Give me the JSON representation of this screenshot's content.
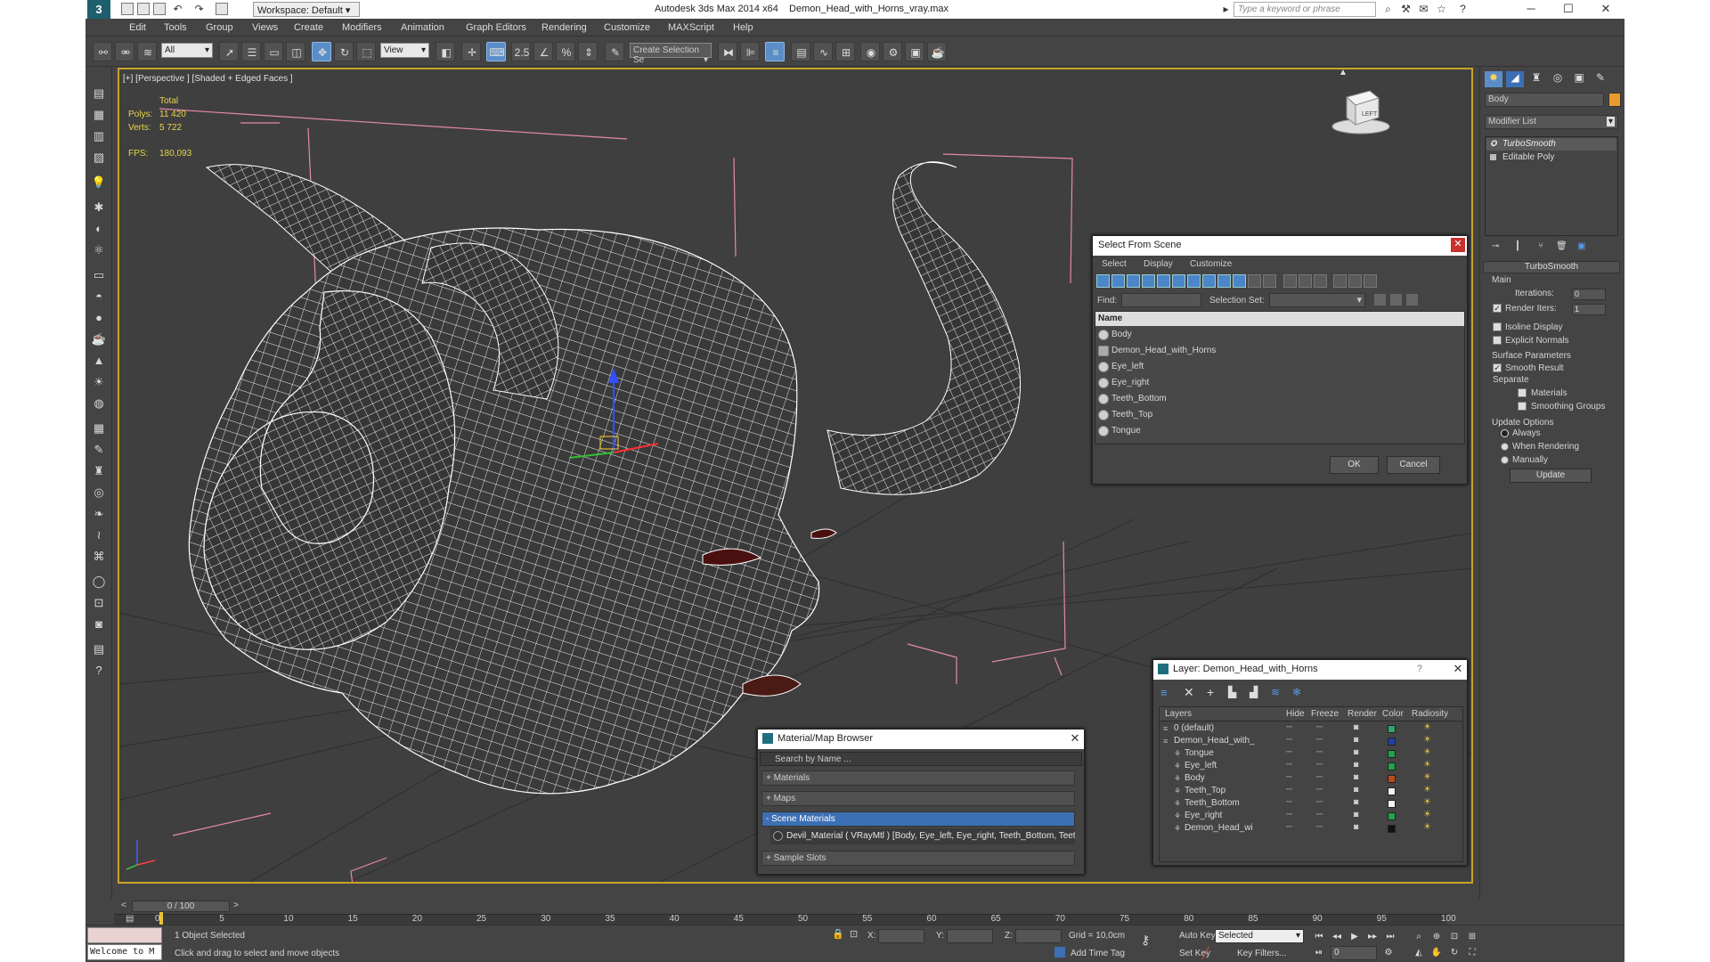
{
  "window": {
    "app_title": "Autodesk 3ds Max  2014 x64",
    "file_name": "Demon_Head_with_Horns_vray.max",
    "workspace": "Workspace: Default",
    "search_placeholder": "Type a keyword or phrase",
    "minimize": "─",
    "maximize": "☐",
    "close": "✕"
  },
  "menu": [
    "Edit",
    "Tools",
    "Group",
    "Views",
    "Create",
    "Modifiers",
    "Animation",
    "Graph Editors",
    "Rendering",
    "Customize",
    "MAXScript",
    "Help"
  ],
  "toolbar": {
    "selection_filter": "All",
    "ref_coord": "View",
    "snap_label": "2.5",
    "angle_snap": "%",
    "named_selection": "Create Selection Se"
  },
  "viewport": {
    "label": "[+] [Perspective ] [Shaded + Edged Faces ]",
    "stats": {
      "total_label": "Total",
      "polys_label": "Polys:",
      "polys_value": "11 420",
      "verts_label": "Verts:",
      "verts_value": "5 722",
      "fps_label": "FPS:",
      "fps_value": "180,093"
    },
    "viewcube_label": "LEFT"
  },
  "select_from_scene": {
    "title": "Select From Scene",
    "menus": [
      "Select",
      "Display",
      "Customize"
    ],
    "find_label": "Find:",
    "selection_set_label": "Selection Set:",
    "column_name": "Name",
    "objects": [
      "Body",
      "Demon_Head_with_Horns",
      "Eye_left",
      "Eye_right",
      "Teeth_Bottom",
      "Teeth_Top",
      "Tongue"
    ],
    "ok": "OK",
    "cancel": "Cancel"
  },
  "material_browser": {
    "title": "Material/Map Browser",
    "search_placeholder": "Search by Name ...",
    "groups": [
      "+ Materials",
      "+ Maps",
      "- Scene Materials"
    ],
    "scene_material": "Devil_Material  ( VRayMtl )  [Body, Eye_left, Eye_right, Teeth_Bottom, Teeth_To...",
    "sample_slots": "+ Sample Slots"
  },
  "layer_dialog": {
    "title": "Layer: Demon_Head_with_Horns",
    "help": "?",
    "columns": [
      "Layers",
      "Hide",
      "Freeze",
      "Render",
      "Color",
      "Radiosity"
    ],
    "layers": [
      {
        "name": "0 (default)",
        "color": "#2fa56a"
      },
      {
        "name": "Demon_Head_with_",
        "color": "#1f3fa5"
      },
      {
        "name": "Tongue",
        "color": "#22a04a"
      },
      {
        "name": "Eye_left",
        "color": "#22a04a"
      },
      {
        "name": "Body",
        "color": "#b84a1e"
      },
      {
        "name": "Teeth_Top",
        "color": "#f2f2f2"
      },
      {
        "name": "Teeth_Bottom",
        "color": "#f2f2f2"
      },
      {
        "name": "Eye_right",
        "color": "#22a04a"
      },
      {
        "name": "Demon_Head_wi",
        "color": "#111111"
      }
    ]
  },
  "command_panel": {
    "object_name": "Body",
    "object_color": "#e89b2a",
    "modifier_list": "Modifier List",
    "stack": [
      "TurboSmooth",
      "Editable Poly"
    ],
    "rollout_title": "TurboSmooth",
    "main_label": "Main",
    "iterations_label": "Iterations:",
    "iterations_value": "0",
    "render_iters_label": "Render Iters:",
    "render_iters_value": "1",
    "render_iters_checked": true,
    "isoline_display": "Isoline Display",
    "explicit_normals": "Explicit Normals",
    "surface_params": "Surface Parameters",
    "smooth_result": "Smooth Result",
    "smooth_result_checked": true,
    "separate": "Separate",
    "materials": "Materials",
    "smoothing_groups": "Smoothing Groups",
    "update_options": "Update Options",
    "always": "Always",
    "when_rendering": "When Rendering",
    "manually": "Manually",
    "update_button": "Update"
  },
  "timeline": {
    "frame_counter": "0 / 100",
    "prev": "<",
    "next": ">",
    "ticks": [
      "0",
      "5",
      "10",
      "15",
      "20",
      "25",
      "30",
      "35",
      "40",
      "45",
      "50",
      "55",
      "60",
      "65",
      "70",
      "75",
      "80",
      "85",
      "90",
      "95",
      "100"
    ]
  },
  "status": {
    "maxscript_listener": "Welcome to M",
    "selection": "1 Object Selected",
    "prompt": "Click and drag to select and move objects",
    "x_label": "X:",
    "y_label": "Y:",
    "z_label": "Z:",
    "grid": "Grid = 10,0cm",
    "add_time_tag": "Add Time Tag",
    "auto_key": "Auto Key",
    "set_key": "Set Key",
    "key_mode": "Selected",
    "key_filters": "Key Filters...",
    "current_frame": "0"
  }
}
